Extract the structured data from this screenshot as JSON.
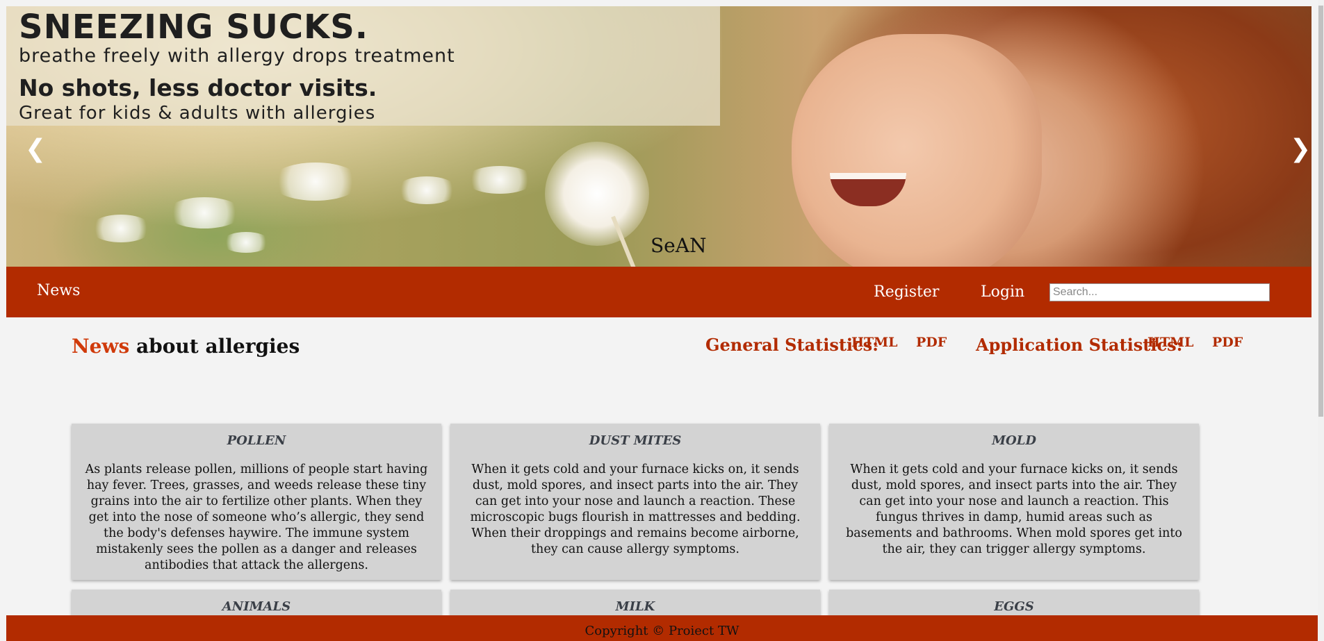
{
  "banner": {
    "headline": "SNEEZING SUCKS.",
    "subline": "breathe freely with allergy drops treatment",
    "headline2": "No shots, less doctor visits.",
    "subline2": "Great for kids & adults with allergies",
    "caption": "SeAN",
    "prev_arrow": "❮",
    "next_arrow": "❯"
  },
  "nav": {
    "news": "News",
    "register": "Register",
    "login": "Login",
    "search_placeholder": "Search..."
  },
  "title": {
    "accent": "News",
    "rest": " about allergies"
  },
  "stats": {
    "general_label": "General Statistics:",
    "general_html": "HTML",
    "general_pdf": "PDF",
    "application_label": "Application Statistics:",
    "application_html": "HTML",
    "application_pdf": "PDF"
  },
  "cards": [
    {
      "title": "POLLEN",
      "text": "As plants release pollen, millions of people start having hay fever. Trees, grasses, and weeds release these tiny grains into the air to fertilize other plants. When they get into the nose of someone who’s allergic, they send the body's defenses haywire. The immune system mistakenly sees the pollen as a danger and releases antibodies that attack the allergens."
    },
    {
      "title": "DUST MITES",
      "text": "When it gets cold and your furnace kicks on, it sends dust, mold spores, and insect parts into the air. They can get into your nose and launch a reaction. These microscopic bugs flourish in mattresses and bedding. When their droppings and remains become airborne, they can cause allergy symptoms."
    },
    {
      "title": "MOLD",
      "text": "When it gets cold and your furnace kicks on, it sends dust, mold spores, and insect parts into the air. They can get into your nose and launch a reaction. This fungus thrives in damp, humid areas such as basements and bathrooms. When mold spores get into the air, they can trigger allergy symptoms."
    },
    {
      "title": "ANIMALS",
      "text": ""
    },
    {
      "title": "MILK",
      "text": ""
    },
    {
      "title": "EGGS",
      "text": ""
    }
  ],
  "footer": {
    "copyright": "Copyright © Proiect TW"
  },
  "colors": {
    "brand": "#b22b00",
    "accent": "#d03a0a",
    "card_bg": "#d3d3d3"
  }
}
